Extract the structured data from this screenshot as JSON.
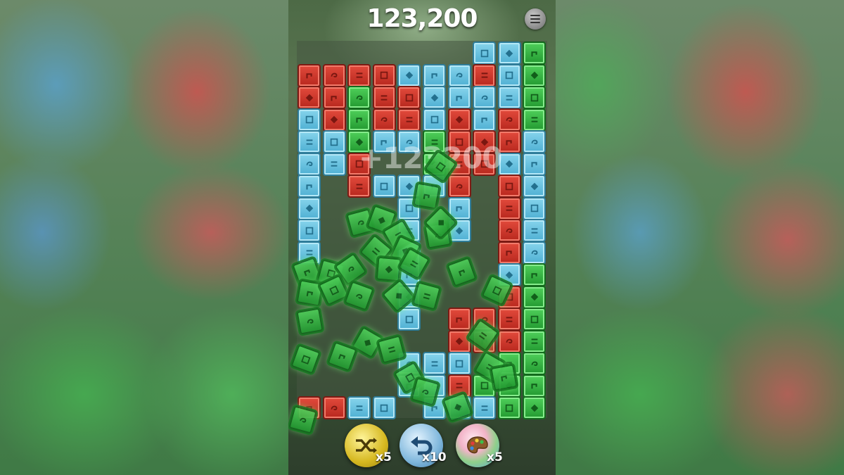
{
  "score": "123,200",
  "popup_score": "+123200",
  "menu": {
    "icon": "hamburger-menu-icon"
  },
  "powerups": [
    {
      "name": "shuffle",
      "icon": "shuffle-icon",
      "count": "x5"
    },
    {
      "name": "undo",
      "icon": "undo-icon",
      "count": "x10"
    },
    {
      "name": "paint",
      "icon": "palette-icon",
      "count": "x5"
    }
  ],
  "colors": {
    "red": "#d73a2e",
    "blue": "#6cc3e2",
    "green": "#35b543"
  },
  "tile_symbols": [
    "spiral",
    "diamond",
    "bars",
    "hook",
    "square"
  ],
  "board": {
    "grid": [
      ". . . . . . . B B G",
      "R R R R B B B R B G",
      "R R G R R B B B B G",
      "B R G R R B R B R G",
      "B B G B B G R R R B",
      "B B R . . G R R B B",
      "B . R B B B R . R B",
      "B . . . B . B . R B",
      "B . . . B . B . R B",
      "B . . . B . . . R B",
      ". . . . B . . . B G",
      ". . . . B . . . R G",
      ". . . . B . R R R G",
      ". . . . . . R R R G",
      ". . . . B B B . G G",
      ". . . . B B R G G G",
      "R R B B . B B B G G"
    ]
  }
}
